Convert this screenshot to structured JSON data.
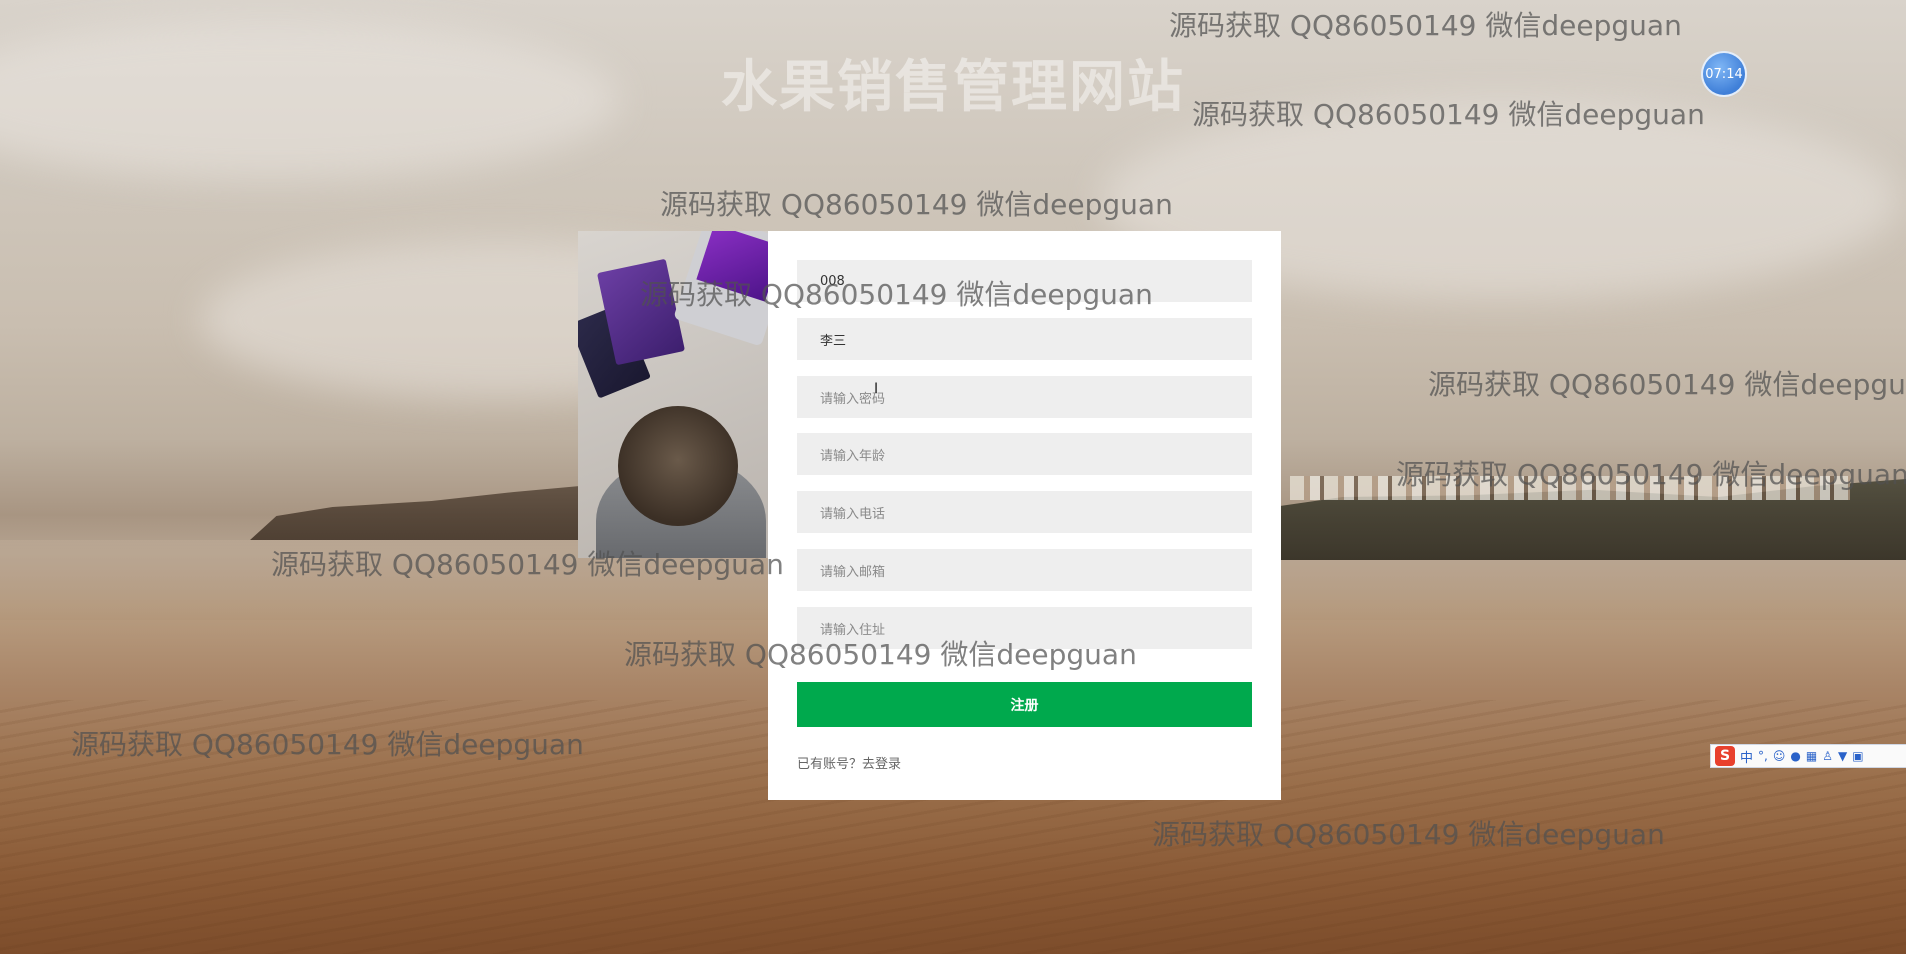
{
  "site": {
    "title": "水果销售管理网站"
  },
  "clock": {
    "time": "07:14"
  },
  "watermark": {
    "text": "源码获取 QQ86050149 微信deepguan"
  },
  "form": {
    "fields": [
      {
        "value": "008",
        "placeholder": ""
      },
      {
        "value": "李三",
        "placeholder": ""
      },
      {
        "value": "",
        "placeholder": "请输入密码"
      },
      {
        "value": "",
        "placeholder": "请输入年龄"
      },
      {
        "value": "",
        "placeholder": "请输入电话"
      },
      {
        "value": "",
        "placeholder": "请输入邮箱"
      },
      {
        "value": "",
        "placeholder": "请输入住址"
      }
    ],
    "submit_label": "注册",
    "login_link": "已有账号？去登录"
  },
  "ime": {
    "logo": "S",
    "mode": "中",
    "punct": "°,",
    "icons": [
      "emoji-icon",
      "microphone-icon",
      "keyboard-icon",
      "user-icon",
      "skin-icon",
      "toolbox-icon"
    ]
  },
  "colors": {
    "accent": "#00a94d",
    "field_bg": "#eeeeee",
    "card_bg": "#ffffff",
    "clock": "#4a8ee6"
  }
}
